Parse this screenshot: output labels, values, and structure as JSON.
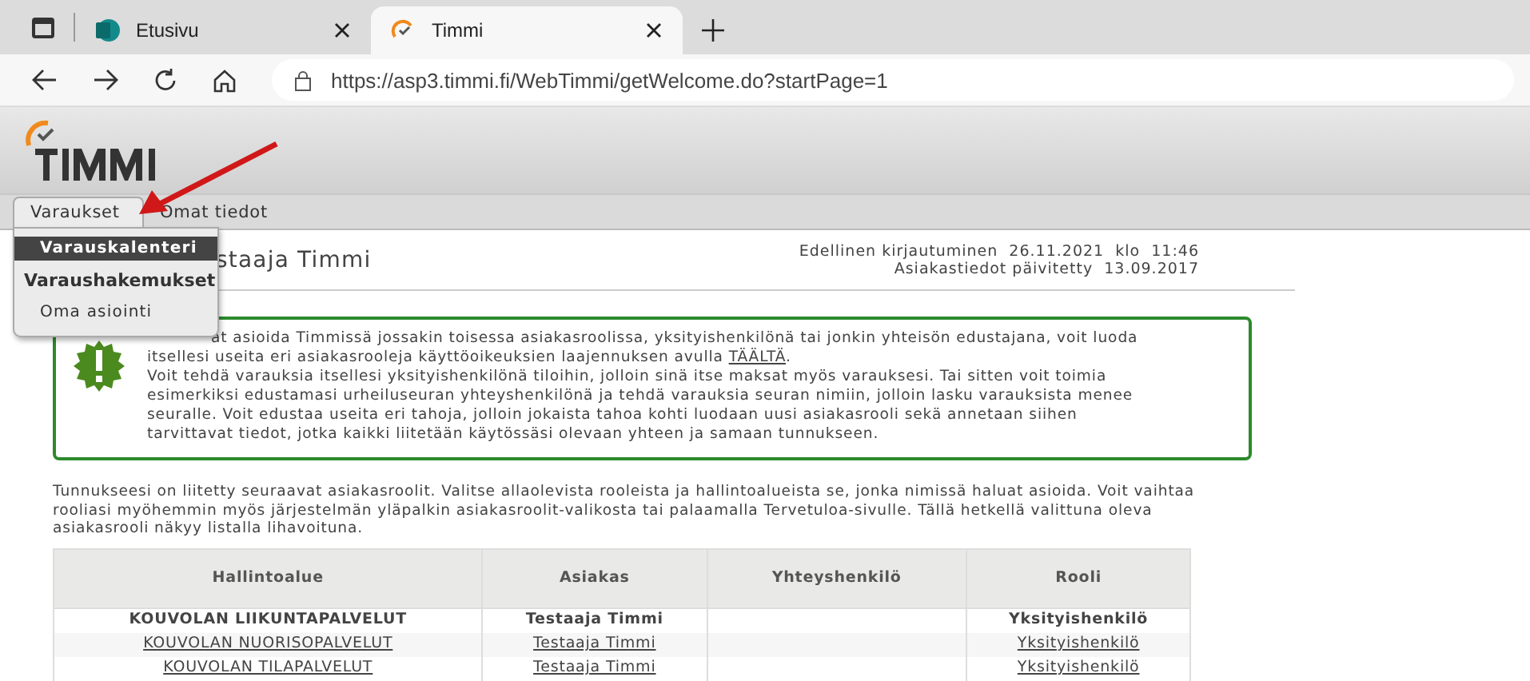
{
  "browser": {
    "tabs": [
      {
        "title": "Etusivu",
        "selected": false
      },
      {
        "title": "Timmi",
        "selected": true
      }
    ],
    "url": "https://asp3.timmi.fi/WebTimmi/getWelcome.do?startPage=1"
  },
  "nav": {
    "tabs": [
      {
        "label": "Varaukset",
        "selected": true
      },
      {
        "label": "Omat tiedot",
        "selected": false
      }
    ],
    "menu": [
      {
        "label": "Varauskalenteri",
        "kind": "item",
        "selected": true
      },
      {
        "label": "Varaushakemukset",
        "kind": "heading",
        "selected": false
      },
      {
        "label": "Oma asiointi",
        "kind": "item",
        "selected": false
      }
    ]
  },
  "heading": "staaja Timmi",
  "last_login": "Edellinen kirjautuminen  26.11.2021  klo  11:46",
  "updated": "Asiakastiedot päivitetty  13.09.2017",
  "notice": {
    "lines": [
      {
        "text": "at asioida Timmissä jossakin toisessa asiakasroolissa, yksityishenkilönä tai jonkin yhteisön edustajana, voit luoda"
      },
      {
        "text": "itsellesi useita eri asiakasrooleja käyttöoikeuksien laajennuksen avulla ",
        "link": "TÄÄLTÄ",
        "after": "."
      },
      {
        "text": "Voit tehdä varauksia itsellesi yksityishenkilönä tiloihin, jolloin sinä itse maksat myös varauksesi. Tai sitten voit toimia"
      },
      {
        "text": "esimerkiksi edustamasi urheiluseuran yhteyshenkilönä ja tehdä varauksia seuran nimiin, jolloin lasku varauksista menee"
      },
      {
        "text": "seuralle. Voit edustaa useita eri tahoja, jolloin jokaista tahoa kohti luodaan uusi asiakasrooli sekä annetaan siihen"
      },
      {
        "text": "tarvittavat tiedot, jotka kaikki liitetään käytössäsi olevaan yhteen ja samaan tunnukseen."
      }
    ]
  },
  "intro": "Tunnukseesi on liitetty seuraavat asiakasroolit. Valitse allaolevista rooleista ja hallintoalueista se, jonka nimissä haluat asioida. Voit vaihtaa rooliasi myöhemmin myös järjestelmän yläpalkin asiakasroolit-valikosta tai palaamalla Tervetuloa-sivulle. Tällä hetkellä valittuna oleva asiakasrooli näkyy listalla lihavoituna.",
  "table": {
    "columns": [
      "Hallintoalue",
      "Asiakas",
      "Yhteyshenkilö",
      "Rooli"
    ],
    "rows": [
      {
        "selected": true,
        "cells": [
          "KOUVOLAN LIIKUNTAPALVELUT",
          "Testaaja Timmi",
          "",
          "Yksityishenkilö"
        ]
      },
      {
        "selected": false,
        "cells": [
          "KOUVOLAN NUORISOPALVELUT",
          "Testaaja Timmi",
          "",
          "Yksityishenkilö"
        ]
      },
      {
        "selected": false,
        "cells": [
          "KOUVOLAN TILAPALVELUT",
          "Testaaja Timmi",
          "",
          "Yksityishenkilö"
        ]
      }
    ]
  }
}
